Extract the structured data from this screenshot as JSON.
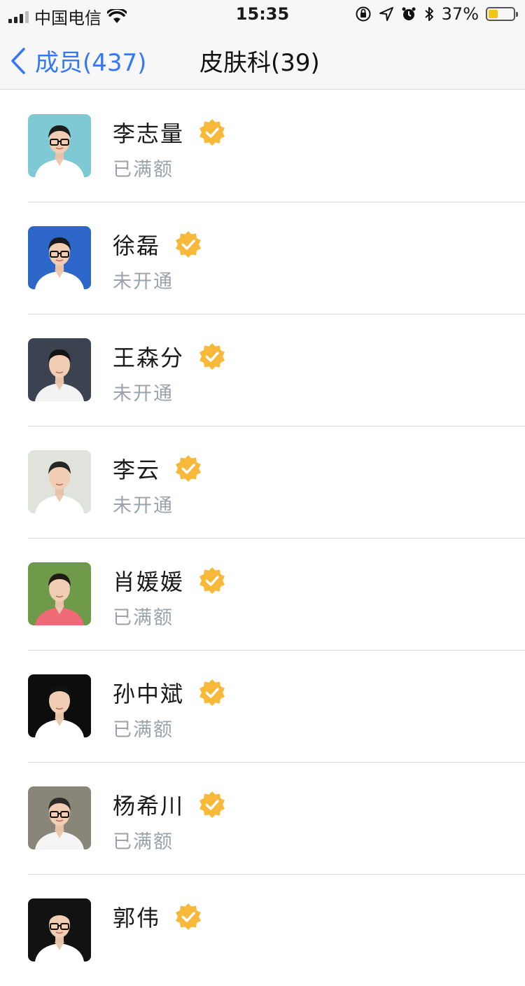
{
  "status_bar": {
    "carrier": "中国电信",
    "time": "15:35",
    "battery_percent": "37%",
    "battery_level": 0.37,
    "icons": [
      "signal-icon",
      "wifi-icon",
      "orientation-lock-icon",
      "location-icon",
      "alarm-icon",
      "bluetooth-icon",
      "battery-icon"
    ]
  },
  "nav": {
    "back_label": "成员(437)",
    "title": "皮肤科(39)"
  },
  "colors": {
    "accent": "#3478f6",
    "badge": "#f8b93a",
    "subtext": "#9aa3ad"
  },
  "members": [
    {
      "name": "李志量",
      "status": "已满额",
      "avatar_bg": "#7fc9d4",
      "avatar_shirt": "#ffffff",
      "avatar_hair": "#1c1c1c",
      "glasses": true
    },
    {
      "name": "徐磊",
      "status": "未开通",
      "avatar_bg": "#2c66c9",
      "avatar_shirt": "#ffffff",
      "avatar_hair": "#1a1a1a",
      "glasses": true
    },
    {
      "name": "王森分",
      "status": "未开通",
      "avatar_bg": "#3b4250",
      "avatar_shirt": "#f2f2f2",
      "avatar_hair": "#151515",
      "glasses": false
    },
    {
      "name": "李云",
      "status": "未开通",
      "avatar_bg": "#dfe3dc",
      "avatar_shirt": "#ffffff",
      "avatar_hair": "#262626",
      "glasses": false
    },
    {
      "name": "肖媛媛",
      "status": "已满额",
      "avatar_bg": "#6f9a4a",
      "avatar_shirt": "#f06a78",
      "avatar_hair": "#221a15",
      "glasses": false
    },
    {
      "name": "孙中斌",
      "status": "已满额",
      "avatar_bg": "#0d0d0d",
      "avatar_shirt": "#ffffff",
      "avatar_hair": "#111111",
      "glasses": false
    },
    {
      "name": "杨希川",
      "status": "已满额",
      "avatar_bg": "#8a8579",
      "avatar_shirt": "#f4f4f4",
      "avatar_hair": "#2b2b2b",
      "glasses": true
    },
    {
      "name": "郭伟",
      "status": "",
      "avatar_bg": "#121212",
      "avatar_shirt": "#ffffff",
      "avatar_hair": "#111111",
      "glasses": true
    }
  ]
}
